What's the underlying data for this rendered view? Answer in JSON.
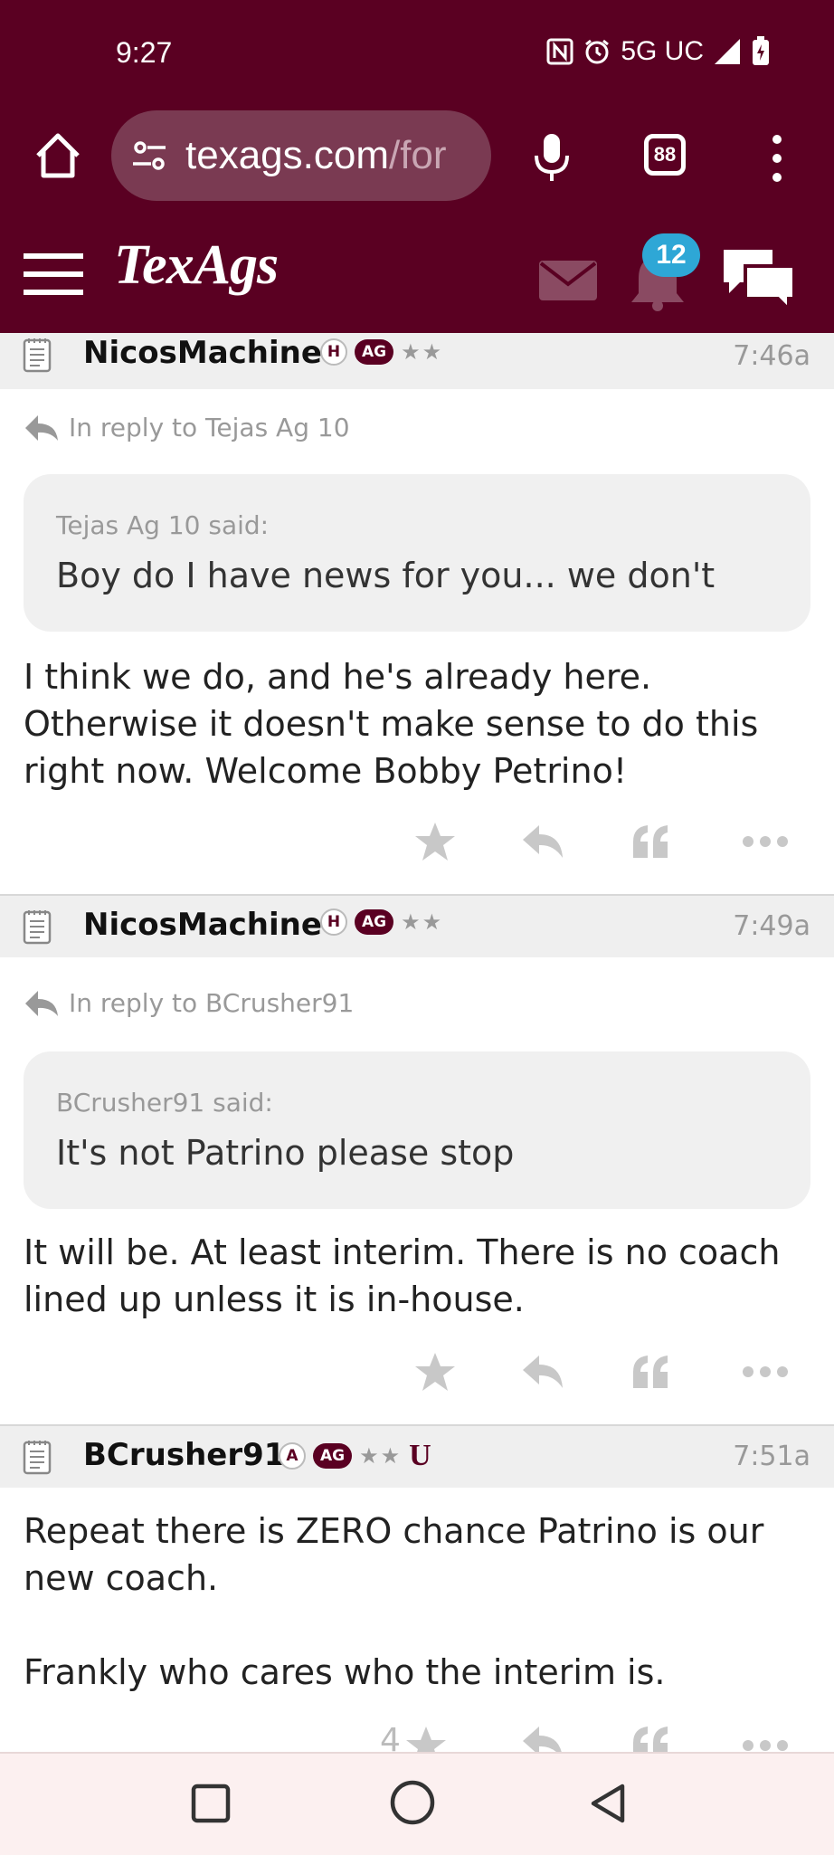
{
  "status": {
    "time": "9:27",
    "network": "5G UC"
  },
  "browser": {
    "url_main": "texags.com",
    "url_rest": "/for",
    "tab_count": "88"
  },
  "site": {
    "logo": "TexAgs",
    "notif_count": "12"
  },
  "posts": [
    {
      "user": "NicosMachine",
      "badge_letter": "H",
      "badge_ag": "AG",
      "stars": "★★",
      "time": "7:46a",
      "reply_to": "In reply to Tejas Ag 10",
      "quote_by": "Tejas Ag 10 said:",
      "quote_text": "Boy do I have news for you... we don't",
      "body": "I think we do, and he's already here. Otherwise it doesn't make sense to do this right now. Welcome Bobby Petrino!"
    },
    {
      "user": "NicosMachine",
      "badge_letter": "H",
      "badge_ag": "AG",
      "stars": "★★",
      "time": "7:49a",
      "reply_to": "In reply to BCrusher91",
      "quote_by": "BCrusher91 said:",
      "quote_text": "It's not Patrino please stop",
      "body": "It will be. At least interim. There is no coach lined up unless it is in-house."
    },
    {
      "user": "BCrusher91",
      "badge_letter": "A",
      "badge_ag": "AG",
      "stars": "★★",
      "umark": "U",
      "time": "7:51a",
      "body_line1": "Repeat there is ZERO chance Patrino is our new coach.",
      "body_line2": "Frankly who cares who the interim is.",
      "star_count": "4"
    }
  ]
}
